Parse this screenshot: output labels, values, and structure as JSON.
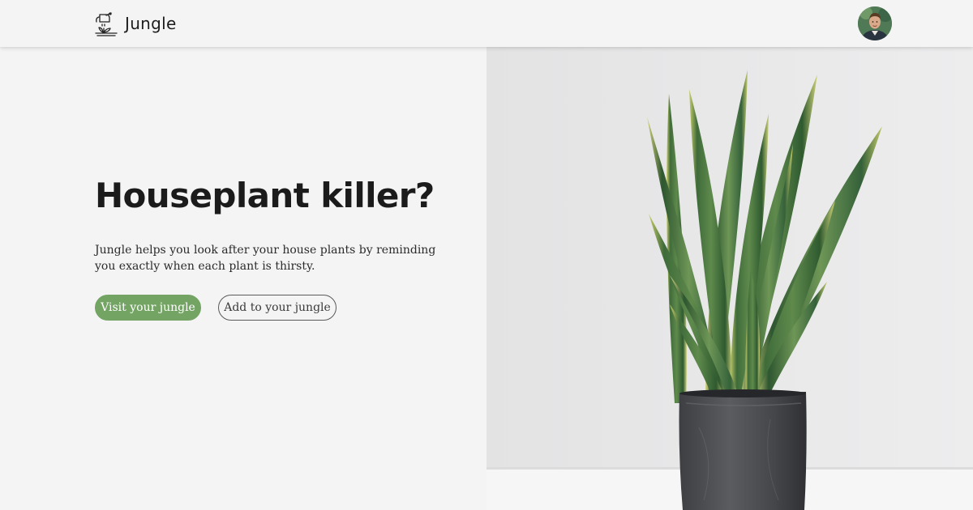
{
  "navbar": {
    "brand_name": "Jungle",
    "logo_icon": "watering-can-plant-icon",
    "avatar_icon": "user-avatar-photo"
  },
  "hero": {
    "headline": "Houseplant killer?",
    "tagline": "Jungle helps you look after your house plants by reminding you exactly when each plant is thirsty.",
    "primary_button": "Visit your jungle",
    "secondary_button": "Add to your jungle",
    "image": "snake-plant-in-dark-pot-photo"
  },
  "colors": {
    "background": "#f4f4f4",
    "accent_green": "#73a464",
    "text": "#1d1d1d"
  }
}
